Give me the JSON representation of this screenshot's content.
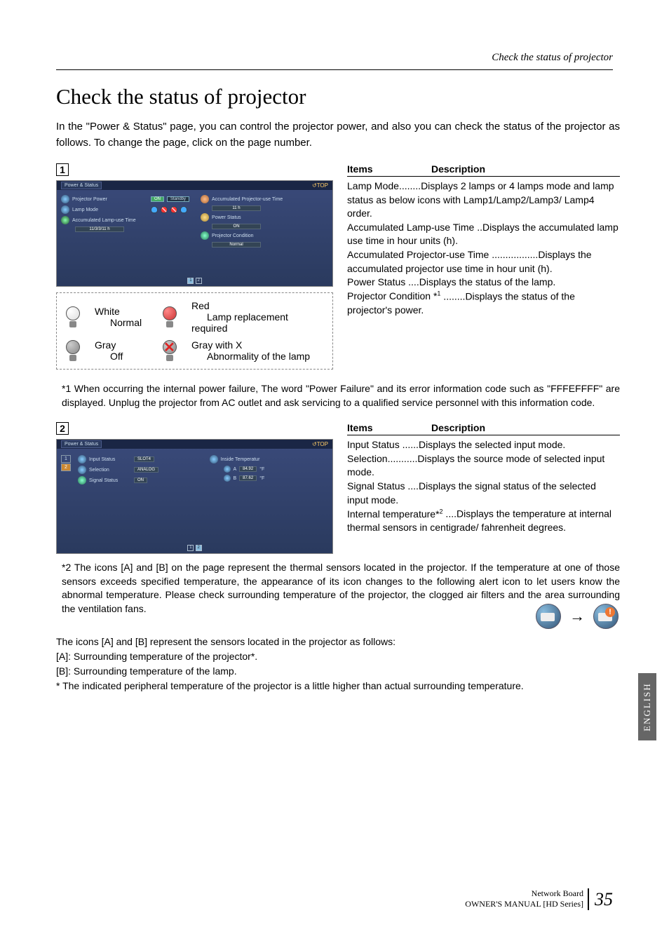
{
  "header_right": "Check the status of projector",
  "title": "Check the status of projector",
  "intro": "In the \"Power & Status\" page, you can control the projector power, and also you can check the status of the projector as follows. To change the page, click on the page number.",
  "indicator1": "1",
  "indicator2": "2",
  "screenshot1": {
    "tab_title": "Power & Status",
    "top_link": "↺TOP",
    "rows": {
      "projector_power": "Projector Power",
      "on": "ON",
      "standby": "Standby",
      "lamp_mode": "Lamp Mode",
      "acc_lamp": "Accumulated Lamp-use Time",
      "acc_lamp_val": "11/3/3/11 h",
      "acc_proj": "Accumulated Projector-use Time",
      "acc_proj_val": "11 h",
      "power_status": "Power Status",
      "power_status_val": "ON",
      "pcond": "Projector Condition",
      "pcond_val": "Normal"
    }
  },
  "legend": {
    "white": "White",
    "white_sub": "Normal",
    "red": "Red",
    "red_sub": "Lamp replacement required",
    "gray": "Gray",
    "gray_sub": "Off",
    "grayx": "Gray with X",
    "grayx_sub": "Abnormality of the lamp"
  },
  "table1": {
    "h1": "Items",
    "h2": "Description",
    "rows": [
      {
        "term": "Lamp Mode",
        "dots": "........",
        "desc": "Displays 2 lamps or 4 lamps mode and lamp status as below icons with Lamp1/Lamp2/Lamp3/ Lamp4 order."
      },
      {
        "term": "Accumulated Lamp-use Time",
        "dots": " ..",
        "desc": "Displays the accumulated lamp use time in hour units (h)."
      },
      {
        "term": "Accumulated Projector-use Time",
        "dots": " .................",
        "desc": "Displays the accumulated projector use time in hour unit (h)."
      },
      {
        "term": "Power Status",
        "dots": " ....",
        "desc": "Displays the status of the lamp."
      },
      {
        "term": "Projector Condition *1",
        "dots": " ........",
        "desc": "Displays the status of the projector's power.",
        "sup": "1"
      }
    ]
  },
  "note1": {
    "prefix": "*1",
    "text": "When occurring the internal power failure, The word \"Power Failure\" and its error information code such as \"FFFEFFFF\" are displayed. Unplug the projector from AC outlet and ask servicing to a qualified service personnel with this information code."
  },
  "screenshot2": {
    "tab_title": "Power & Status",
    "top_link": "↺TOP",
    "rows": {
      "input_status": "Input Status",
      "input_status_val": "SLOT4",
      "selection": "Selection",
      "selection_val": "ANALOG",
      "signal": "Signal Status",
      "signal_val": "ON",
      "inside_temp": "Inside Temperatur",
      "a_label": "A",
      "a_val": "84.92",
      "a_unit": "°F",
      "b_label": "B",
      "b_val": "87.62",
      "b_unit": "°F"
    }
  },
  "table2": {
    "h1": "Items",
    "h2": "Description",
    "rows": [
      {
        "term": "Input Status",
        "dots": " ......",
        "desc": "Displays the selected input mode."
      },
      {
        "term": "Selection",
        "dots": "...........",
        "desc": "Displays the source mode of selected input mode."
      },
      {
        "term": "Signal Status",
        "dots": " ....",
        "desc": "Displays the signal status of the selected input mode."
      },
      {
        "term": "Internal temperature*2",
        "dots": " ....",
        "desc": "Displays the temperature at internal thermal sensors in centigrade/ fahrenheit degrees.",
        "sup": "2"
      }
    ]
  },
  "note2": {
    "prefix": "*2",
    "text": "The icons [A] and [B] on the page represent the thermal sensors located in the projector. If the temperature at one of those sensors exceeds specified temperature, the appearance of its icon changes to the following alert icon to let users know the abnormal temperature. Please check surrounding temperature of the projector, the clogged air filters and the area surrounding the ventilation fans."
  },
  "plain_notes": {
    "l1": "The icons [A] and [B] represent the sensors located in the projector as follows:",
    "l2": "[A]: Surrounding temperature of the projector*.",
    "l3": "[B]: Surrounding temperature of the lamp.",
    "l4": "* The indicated peripheral temperature of the projector is a little higher than actual surrounding temperature."
  },
  "side_tab": "ENGLISH",
  "footer": {
    "line1": "Network Board",
    "line2": "OWNER'S MANUAL [HD Series]",
    "page": "35"
  }
}
